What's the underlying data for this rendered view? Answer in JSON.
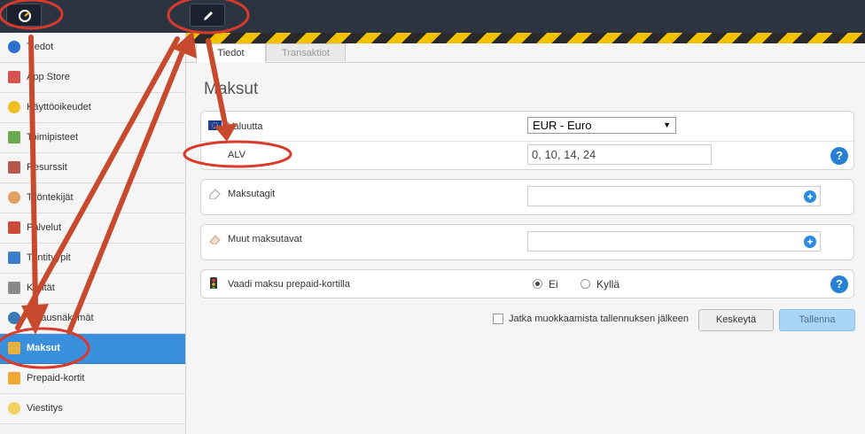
{
  "sidebar": {
    "items": [
      {
        "label": "Tiedot",
        "icon": "info-icon",
        "color": "#2a6fd1"
      },
      {
        "label": "App Store",
        "icon": "store-icon",
        "color": "#d9534f"
      },
      {
        "label": "Käyttöoikeudet",
        "icon": "star-icon",
        "color": "#f0c020"
      },
      {
        "label": "Toimipisteet",
        "icon": "map-icon",
        "color": "#6aa84f"
      },
      {
        "label": "Resurssit",
        "icon": "house-icon",
        "color": "#b9574f"
      },
      {
        "label": "Työntekijät",
        "icon": "people-icon",
        "color": "#e0a060"
      },
      {
        "label": "Palvelut",
        "icon": "calendar-icon",
        "color": "#d04a3a"
      },
      {
        "label": "Tuntityypit",
        "icon": "calendar-blue-icon",
        "color": "#3c7ec9"
      },
      {
        "label": "Kentät",
        "icon": "form-icon",
        "color": "#8a8a8a"
      },
      {
        "label": "Varausnäkymät",
        "icon": "globe-icon",
        "color": "#3a78b8"
      },
      {
        "label": "Maksut",
        "icon": "payment-icon",
        "color": "#e8b040"
      },
      {
        "label": "Prepaid-kortit",
        "icon": "card-icon",
        "color": "#f0a830"
      },
      {
        "label": "Viestitys",
        "icon": "chat-icon",
        "color": "#f0d060"
      }
    ],
    "active_label": "Maksut"
  },
  "tabs": [
    {
      "label": "Tiedot"
    },
    {
      "label": "Transaktiot"
    }
  ],
  "page_title": "Maksut",
  "form": {
    "currency": {
      "label": "Valuutta",
      "value": "EUR - Euro"
    },
    "vat": {
      "label": "ALV",
      "value": "0, 10, 14, 24"
    },
    "payment_tags": {
      "label": "Maksutagit",
      "value": ""
    },
    "other_methods": {
      "label": "Muut maksutavat",
      "value": ""
    },
    "prepaid": {
      "label": "Vaadi maksu prepaid-kortilla",
      "option_no": "Ei",
      "option_yes": "Kyllä",
      "selected": "Ei"
    }
  },
  "footer": {
    "continue_label": "Jatka muokkaamista tallennuksen jälkeen",
    "cancel_label": "Keskeytä",
    "save_label": "Tallenna"
  },
  "help_label": "?",
  "plus_label": "+",
  "colors": {
    "accent": "#3a8fdc",
    "annotation": "#d93a2b",
    "topbar": "#2c3442"
  }
}
